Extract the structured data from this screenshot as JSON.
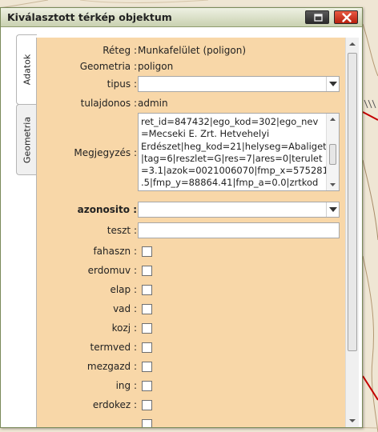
{
  "window": {
    "title": "Kiválasztott térkép objektum"
  },
  "tabs": [
    {
      "label": "Adatok",
      "active": true
    },
    {
      "label": "Geometria",
      "active": false
    }
  ],
  "fields": {
    "reteg": {
      "label": "Réteg :",
      "value": "Munkafelület (poligon)"
    },
    "geometria": {
      "label": "Geometria :",
      "value": "poligon"
    },
    "tipus": {
      "label": "tipus :",
      "value": ""
    },
    "tulajdonos": {
      "label": "tulajdonos :",
      "value": "admin"
    },
    "megjegyzes": {
      "label": "Megjegyzés :",
      "value": "ret_id=847432|ego_kod=302|ego_nev\n=Mecseki E. Zrt. Hetvehelyi\nErdészet|heg_kod=21|helyseg=Abaliget\n|tag=6|reszlet=G|res=7|ares=0|terulet\n=3.1|azok=0021006070|fmp_x=575281\n.5|fmp_y=88864.41|fmp_a=0.0|zrtkod"
    },
    "azonosito": {
      "label": "azonosito :",
      "value": ""
    },
    "teszt": {
      "label": "teszt :",
      "value": ""
    }
  },
  "checkboxes": [
    {
      "label": "fahaszn :",
      "checked": false
    },
    {
      "label": "erdomuv :",
      "checked": false
    },
    {
      "label": "elap :",
      "checked": false
    },
    {
      "label": "vad :",
      "checked": false
    },
    {
      "label": "kozj :",
      "checked": false
    },
    {
      "label": "termved :",
      "checked": false
    },
    {
      "label": "mezgazd :",
      "checked": false
    },
    {
      "label": "ing :",
      "checked": false
    },
    {
      "label": "erdokez :",
      "checked": false
    }
  ],
  "colors": {
    "panel_bg": "#f8d7a8",
    "close_button": "#d23a22",
    "titlebar": "#c9d1b0"
  },
  "icons": {
    "minimize": "window-minimize-icon",
    "close": "close-icon"
  }
}
